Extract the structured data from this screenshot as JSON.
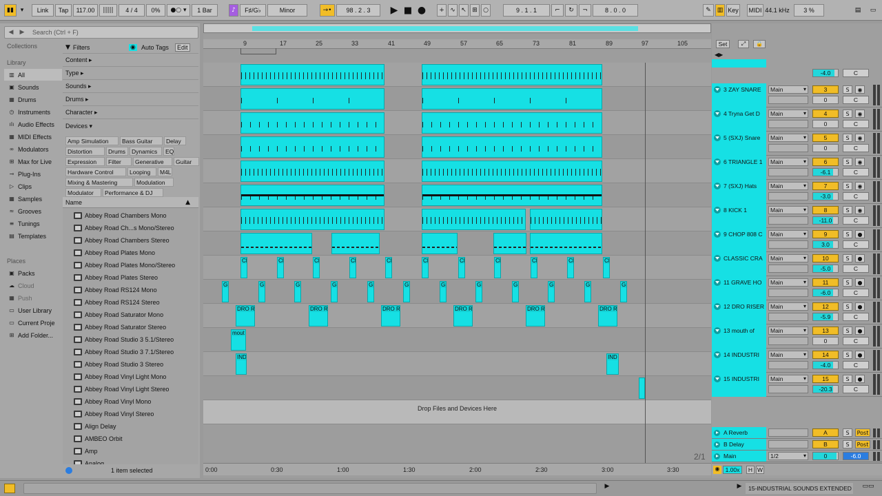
{
  "colors": {
    "clip": "#16e0e4",
    "accent": "#f1bd27",
    "purple": "#a55ee0",
    "panel": "#a7a7a7"
  },
  "topbar": {
    "link": "Link",
    "tap": "Tap",
    "tempo": "117.00",
    "signature": "4 / 4",
    "groove_pct": "0%",
    "quantize": "1 Bar",
    "key_root": "F♯/G♭",
    "scale": "Minor",
    "arr_pos": "98 .  2 .  3",
    "loop_start": "9 .  1 .  1",
    "loop_len": "8 .  0 .  0",
    "key_label": "Key",
    "midi_label": "MIDI",
    "sample_rate": "44.1 kHz",
    "cpu": "3 %"
  },
  "browser": {
    "search_placeholder": "Search (Ctrl + F)",
    "collections_label": "Collections",
    "library_label": "Library",
    "library": [
      "All",
      "Sounds",
      "Drums",
      "Instruments",
      "Audio Effects",
      "MIDI Effects",
      "Modulators",
      "Max for Live",
      "Plug-Ins",
      "Clips",
      "Samples",
      "Grooves",
      "Tunings",
      "Templates"
    ],
    "places_label": "Places",
    "places": [
      "Packs",
      "Cloud",
      "Push",
      "User Library",
      "Current Proje",
      "Add Folder..."
    ],
    "filters_label": "Filters",
    "auto_tags": "Auto Tags",
    "edit": "Edit",
    "filter_rows": [
      "Content ▸",
      "Type ▸",
      "Sounds ▸",
      "Drums ▸",
      "Character ▸",
      "Devices ▾"
    ],
    "tags": [
      [
        "Amp Simulation",
        "Bass Guitar",
        "Delay"
      ],
      [
        "Distortion",
        "Drums",
        "Dynamics",
        "EQ"
      ],
      [
        "Expression",
        "Filter",
        "Generative",
        "Guitar"
      ],
      [
        "Hardware Control",
        "Looping",
        "M4L"
      ],
      [
        "Mixing & Mastering",
        "Modulation"
      ],
      [
        "Modulator",
        "Performance & DJ"
      ]
    ],
    "name_header": "Name",
    "items": [
      "Abbey Road Chambers Mono",
      "Abbey Road Ch...s Mono/Stereo",
      "Abbey Road Chambers Stereo",
      "Abbey Road Plates Mono",
      "Abbey Road Plates Mono/Stereo",
      "Abbey Road Plates Stereo",
      "Abbey Road RS124 Mono",
      "Abbey Road RS124 Stereo",
      "Abbey Road Saturator Mono",
      "Abbey Road Saturator Stereo",
      "Abbey Road Studio 3 5.1/Stereo",
      "Abbey Road Studio 3 7.1/Stereo",
      "Abbey Road Studio 3 Stereo",
      "Abbey Road Vinyl Light Mono",
      "Abbey Road Vinyl Light Stereo",
      "Abbey Road Vinyl Mono",
      "Abbey Road Vinyl Stereo",
      "Align Delay",
      "AMBEO Orbit",
      "Amp",
      "Analog"
    ],
    "status": "1 item selected"
  },
  "arrangement": {
    "bars": [
      "9",
      "17",
      "25",
      "33",
      "41",
      "49",
      "57",
      "65",
      "73",
      "81",
      "89",
      "97",
      "105"
    ],
    "times": [
      "0:00",
      "0:30",
      "1:00",
      "1:30",
      "2:00",
      "2:30",
      "3:00",
      "3:30"
    ],
    "drop_text": "Drop Files and Devices Here",
    "set_label": "Set",
    "clip_labels": {
      "cl": "CL",
      "gr": "GR",
      "dro": "DRO R",
      "mout": "mout",
      "ind": "IND"
    }
  },
  "mixer": {
    "partial_vol": "-4.0",
    "tracks": [
      {
        "name": "3 ZAY SNARE",
        "route": "Main",
        "num": "3",
        "vol": "0",
        "pan": "C"
      },
      {
        "name": "4 Tryna Get D",
        "route": "Main",
        "num": "4",
        "vol": "0",
        "pan": "C"
      },
      {
        "name": "5 (SXJ) Snare",
        "route": "Main",
        "num": "5",
        "vol": "0",
        "pan": "C"
      },
      {
        "name": "6 TRIANGLE 1",
        "route": "Main",
        "num": "6",
        "vol": "-6.1",
        "pan": "C"
      },
      {
        "name": "7 (SXJ) Hats",
        "route": "Main",
        "num": "7",
        "vol": "-3.0",
        "pan": "C"
      },
      {
        "name": "8 KICK 1",
        "route": "Main",
        "num": "8",
        "vol": "-11.0",
        "pan": "C"
      },
      {
        "name": "9 CHOP 808 C",
        "route": "Main",
        "num": "9",
        "vol": "3.0",
        "pan": "C"
      },
      {
        "name": "CLASSIC CRA",
        "route": "Main",
        "num": "10",
        "vol": "-5.0",
        "pan": "C"
      },
      {
        "name": "11 GRAVE HO",
        "route": "Main",
        "num": "11",
        "vol": "-6.0",
        "pan": "C"
      },
      {
        "name": "12 DRO RISER",
        "route": "Main",
        "num": "12",
        "vol": "-5.9",
        "pan": "C"
      },
      {
        "name": "13 mouth of",
        "route": "Main",
        "num": "13",
        "vol": "0",
        "pan": "C"
      },
      {
        "name": "14 INDUSTRI",
        "route": "Main",
        "num": "14",
        "vol": "-4.0",
        "pan": "C"
      },
      {
        "name": "15 INDUSTRI",
        "route": "Main",
        "num": "15",
        "vol": "-20.3",
        "pan": "C"
      }
    ],
    "returns": [
      {
        "name": "A Reverb",
        "num": "A",
        "post": "Post"
      },
      {
        "name": "B Delay",
        "num": "B",
        "post": "Post"
      }
    ],
    "main": {
      "name": "Main",
      "route": "1/2",
      "num": "0",
      "vol": "-6.0"
    },
    "page": "2/1",
    "zoom": "1.00x",
    "h": "H",
    "w": "W",
    "solo": "S"
  },
  "statusbar": {
    "track_name": "15-INDUSTRIAL SOUNDS EXTENDED"
  }
}
